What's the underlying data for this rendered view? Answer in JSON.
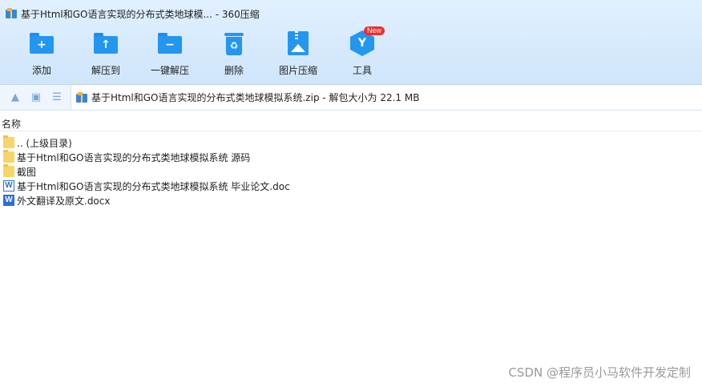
{
  "window": {
    "title": "基于Html和GO语言实现的分布式类地球模... - 360压缩"
  },
  "toolbar": {
    "items": [
      {
        "label": "添加",
        "icon": "add-folder-icon"
      },
      {
        "label": "解压到",
        "icon": "extract-folder-icon"
      },
      {
        "label": "一键解压",
        "icon": "one-click-extract-icon"
      },
      {
        "label": "删除",
        "icon": "recycle-bin-icon"
      },
      {
        "label": "图片压缩",
        "icon": "image-compress-icon"
      },
      {
        "label": "工具",
        "icon": "tools-icon",
        "badge": "New"
      }
    ]
  },
  "address": {
    "text": "基于Html和GO语言实现的分布式类地球模拟系统.zip - 解包大小为 22.1 MB"
  },
  "list": {
    "column_name": "名称",
    "rows": [
      {
        "name": ".. (上级目录)",
        "type": "folder"
      },
      {
        "name": "基于Html和GO语言实现的分布式类地球模拟系统 源码",
        "type": "folder"
      },
      {
        "name": "截图",
        "type": "folder"
      },
      {
        "name": "基于Html和GO语言实现的分布式类地球模拟系统 毕业论文.doc",
        "type": "doc"
      },
      {
        "name": "外文翻译及原文.docx",
        "type": "docx"
      }
    ]
  },
  "watermark": "CSDN @程序员小马软件开发定制",
  "colors": {
    "accent": "#2396f0",
    "badge": "#ef2d2d",
    "folder": "#f8d568"
  }
}
